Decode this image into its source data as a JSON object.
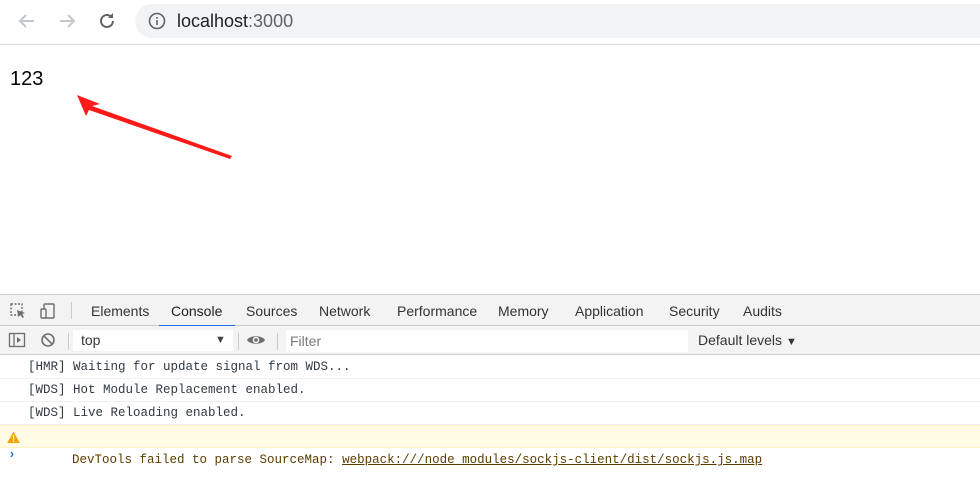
{
  "browser": {
    "url_host": "localhost",
    "url_port": ":3000"
  },
  "page": {
    "text": "123"
  },
  "devtools": {
    "tabs": [
      {
        "label": "Elements"
      },
      {
        "label": "Console",
        "active": true
      },
      {
        "label": "Sources"
      },
      {
        "label": "Network"
      },
      {
        "label": "Performance"
      },
      {
        "label": "Memory"
      },
      {
        "label": "Application"
      },
      {
        "label": "Security"
      },
      {
        "label": "Audits"
      }
    ],
    "context": "top",
    "filter_placeholder": "Filter",
    "levels_label": "Default levels",
    "messages": [
      {
        "text": "[HMR] Waiting for update signal from WDS..."
      },
      {
        "text": "[WDS] Hot Module Replacement enabled."
      },
      {
        "text": "[WDS] Live Reloading enabled."
      }
    ],
    "warning": {
      "prefix": "DevTools failed to parse SourceMap: ",
      "link": "webpack:///node_modules/sockjs-client/dist/sockjs.js.map"
    },
    "prompt": "›"
  },
  "colors": {
    "accent": "#1a73e8",
    "annotation_arrow": "#ff0000",
    "warning_bg": "#fffbe5"
  }
}
